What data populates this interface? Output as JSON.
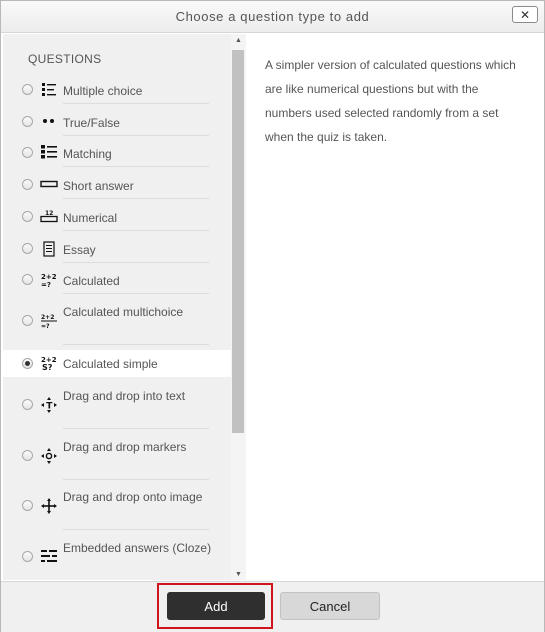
{
  "dialog": {
    "title": "Choose a question type to add",
    "close_glyph": "✕"
  },
  "options_panel": {
    "section_label": "QUESTIONS",
    "items": [
      {
        "label": "Multiple choice",
        "icon": "multiple-choice-icon",
        "selected": false
      },
      {
        "label": "True/False",
        "icon": "true-false-icon",
        "selected": false
      },
      {
        "label": "Matching",
        "icon": "matching-icon",
        "selected": false
      },
      {
        "label": "Short answer",
        "icon": "short-answer-icon",
        "selected": false
      },
      {
        "label": "Numerical",
        "icon": "numerical-icon",
        "selected": false
      },
      {
        "label": "Essay",
        "icon": "essay-icon",
        "selected": false
      },
      {
        "label": "Calculated",
        "icon": "calculated-icon",
        "selected": false
      },
      {
        "label": "Calculated multichoice",
        "icon": "calculated-multichoice-icon",
        "selected": false
      },
      {
        "label": "Calculated simple",
        "icon": "calculated-simple-icon",
        "selected": true
      },
      {
        "label": "Drag and drop into text",
        "icon": "drag-drop-text-icon",
        "selected": false
      },
      {
        "label": "Drag and drop markers",
        "icon": "drag-drop-markers-icon",
        "selected": false
      },
      {
        "label": "Drag and drop onto image",
        "icon": "drag-drop-image-icon",
        "selected": false
      },
      {
        "label": "Embedded answers (Cloze)",
        "icon": "embedded-answers-icon",
        "selected": false
      }
    ]
  },
  "description": "A simpler version of calculated questions which are like numerical questions but with the numbers used selected randomly from a set when the quiz is taken.",
  "footer": {
    "add_label": "Add",
    "cancel_label": "Cancel"
  },
  "colors": {
    "highlight": "#d0141e",
    "primary_button": "#2f2f2f"
  }
}
